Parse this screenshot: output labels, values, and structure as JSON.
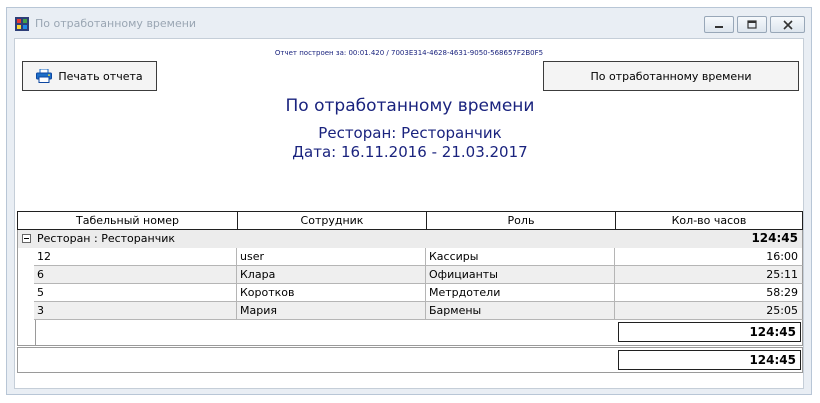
{
  "window": {
    "title": "По отработанному времени",
    "icons": {
      "app": "report-app-icon",
      "minimize": "minimize-icon",
      "maximize": "maximize-icon",
      "close": "close-icon"
    }
  },
  "report": {
    "build_info": "Отчет построен за: 00:01.420 / 7003E314-4628-4631-9050-568657F2B0F5",
    "print_button": "Печать отчета",
    "print_icon": "printer-icon",
    "report_button": "По отработанному времени",
    "title": "По отработанному времени",
    "restaurant_line": "Ресторан: Ресторанчик",
    "date_line": "Дата: 16.11.2016 - 21.03.2017"
  },
  "table": {
    "columns": [
      "Табельный номер",
      "Сотрудник",
      "Роль",
      "Кол-во часов"
    ],
    "group": {
      "label": "Ресторан : Ресторанчик",
      "total": "124:45",
      "rows": [
        {
          "id": "12",
          "employee": "user",
          "role": "Кассиры",
          "hours": "16:00"
        },
        {
          "id": "6",
          "employee": "Клара",
          "role": "Официанты",
          "hours": "25:11"
        },
        {
          "id": "5",
          "employee": "Коротков",
          "role": "Метрдотели",
          "hours": "58:29"
        },
        {
          "id": "3",
          "employee": "Мария",
          "role": "Бармены",
          "hours": "25:05"
        }
      ],
      "footer_total": "124:45"
    },
    "grand_total": "124:45"
  }
}
